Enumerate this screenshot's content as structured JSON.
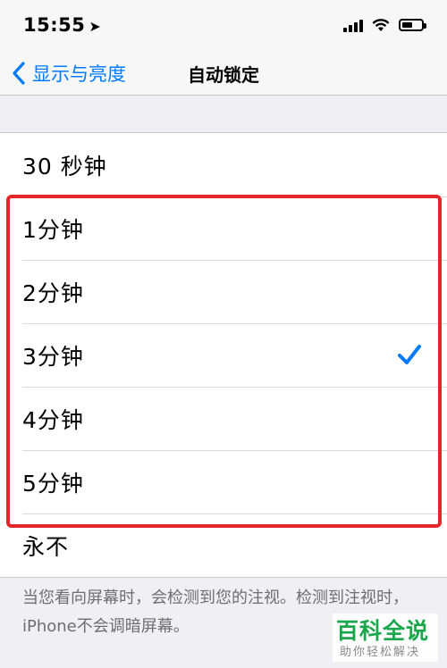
{
  "status_bar": {
    "time": "15:55",
    "location_icon": "location-arrow-icon",
    "battery_level": 0.62
  },
  "nav": {
    "back_label": "显示与亮度",
    "title": "自动锁定"
  },
  "options": [
    {
      "label": "30 秒钟",
      "selected": false
    },
    {
      "label": "1分钟",
      "selected": false
    },
    {
      "label": "2分钟",
      "selected": false
    },
    {
      "label": "3分钟",
      "selected": true
    },
    {
      "label": "4分钟",
      "selected": false
    },
    {
      "label": "5分钟",
      "selected": false
    },
    {
      "label": "永不",
      "selected": false
    }
  ],
  "footer_note": "当您看向屏幕时，会检测到您的注视。检测到注视时，iPhone不会调暗屏幕。",
  "watermark": {
    "title": "百科全说",
    "subtitle": "助你轻松解决"
  },
  "colors": {
    "accent": "#007aff",
    "highlight_border": "#e4262a",
    "watermark_green": "#1aa64b"
  }
}
